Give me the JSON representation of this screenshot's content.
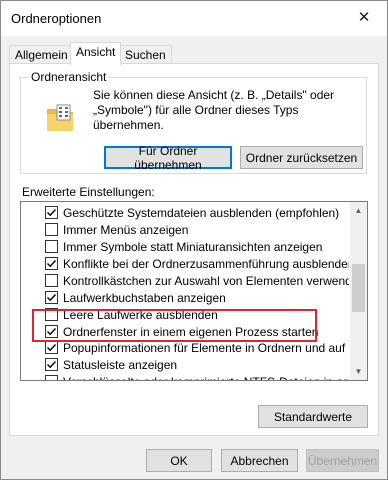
{
  "window": {
    "title": "Ordneroptionen",
    "close_glyph": "✕"
  },
  "tabs": [
    {
      "label": "Allgemein",
      "active": false
    },
    {
      "label": "Ansicht",
      "active": true
    },
    {
      "label": "Suchen",
      "active": false
    }
  ],
  "folder_view": {
    "title": "Ordneransicht",
    "description": "Sie können diese Ansicht (z. B. „Details\" oder „Symbole\") für alle Ordner dieses Typs übernehmen.",
    "apply_button": "Für Ordner übernehmen",
    "reset_button": "Ordner zurücksetzen"
  },
  "advanced": {
    "label": "Erweiterte Einstellungen:",
    "items": [
      {
        "label": "Geschützte Systemdateien ausblenden (empfohlen)",
        "checked": true
      },
      {
        "label": "Immer Menüs anzeigen",
        "checked": false
      },
      {
        "label": "Immer Symbole statt Miniaturansichten anzeigen",
        "checked": false
      },
      {
        "label": "Konflikte bei der Ordnerzusammenführung ausblenden",
        "checked": true
      },
      {
        "label": "Kontrollkästchen zur Auswahl von Elementen verwenden",
        "checked": false
      },
      {
        "label": "Laufwerkbuchstaben anzeigen",
        "checked": true
      },
      {
        "label": "Leere Laufwerke ausblenden",
        "checked": false
      },
      {
        "label": "Ordnerfenster in einem eigenen Prozess starten",
        "checked": true
      },
      {
        "label": "Popupinformationen für Elemente in Ordnern und auf dem D",
        "checked": true
      },
      {
        "label": "Statusleiste anzeigen",
        "checked": true
      },
      {
        "label": "Verschlüsselte oder komprimierte NTFS-Dateien in anderer",
        "checked": false
      }
    ]
  },
  "defaults_button": "Standardwerte",
  "footer": {
    "ok": "OK",
    "cancel": "Abbrechen",
    "apply": "Übernehmen"
  },
  "colors": {
    "highlight": "#e0262d",
    "focus": "#0078d7"
  }
}
